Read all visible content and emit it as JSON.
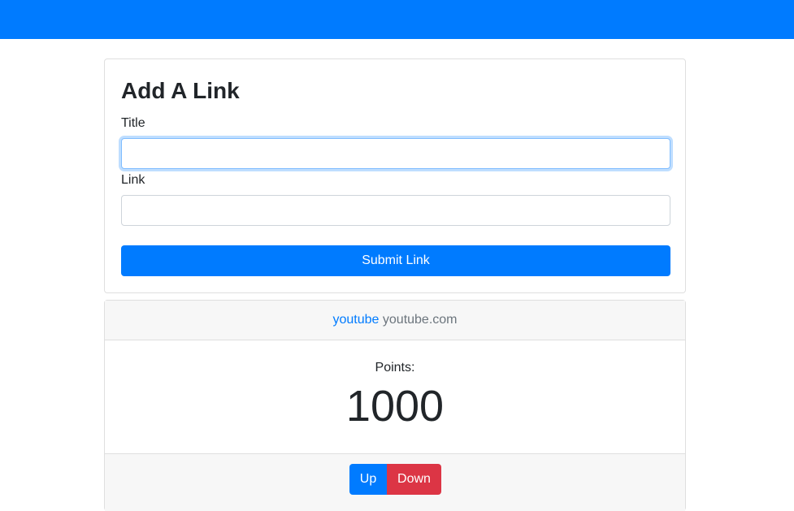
{
  "form": {
    "heading": "Add A Link",
    "title_label": "Title",
    "title_value": "",
    "link_label": "Link",
    "link_value": "",
    "submit_label": "Submit Link"
  },
  "links": [
    {
      "title": "youtube",
      "domain": "youtube.com",
      "points_label": "Points:",
      "points": "1000",
      "up_label": "Up",
      "down_label": "Down"
    }
  ],
  "colors": {
    "primary": "#007bff",
    "danger": "#dc3545",
    "card_header_bg": "#f7f7f7"
  }
}
